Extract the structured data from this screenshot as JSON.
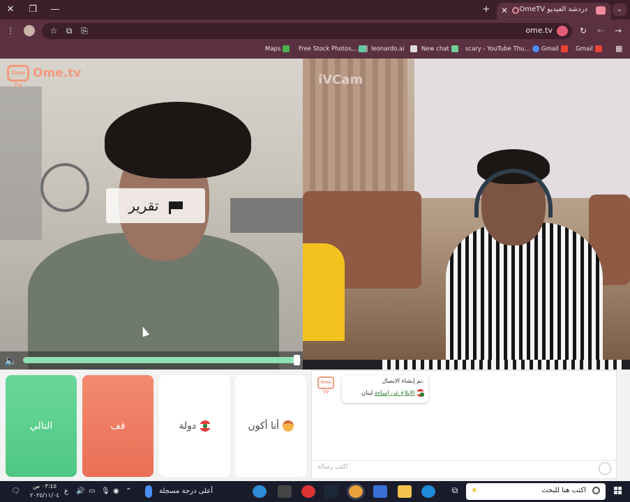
{
  "browser": {
    "tab_title": "دردشة الفيديو OmeTV — بد",
    "url": "ome.tv",
    "window_controls": [
      "close-icon",
      "restore-icon",
      "minimize-icon"
    ],
    "bookmarks": [
      {
        "label": "Maps",
        "icon": "maps-icon"
      },
      {
        "label": "Free Stock Photos,...",
        "icon": "photos-icon"
      },
      {
        "label": "leonardo.ai",
        "icon": "leonardo-icon"
      },
      {
        "label": "New chat",
        "icon": "chatgpt-icon"
      },
      {
        "label": "scary - YouTube Thu...",
        "icon": "web-icon"
      },
      {
        "label": "Gmail",
        "icon": "gmail-icon"
      },
      {
        "label": "Gmail",
        "icon": "gmail-icon"
      }
    ]
  },
  "video": {
    "logo_word": "Ome.tv",
    "logo_badge": "Ome TV",
    "watermark": "iVCam",
    "report_label": "تقرير",
    "volume_level": 0.99
  },
  "controls": {
    "next_label": "التالي",
    "stop_label": "قف",
    "country_label": "دولة",
    "gender_label": "أنا أكون"
  },
  "chat": {
    "line1": "تم إنشاء الاتصال.",
    "country": "لبنان",
    "report_link": "الإبلاغ عن إساءة",
    "placeholder": "اكتب رسالة"
  },
  "taskbar": {
    "search_placeholder": "اكتب هنا للبحث",
    "weather": "أعلى درجة مسجلة",
    "time": "٠٣:٤٥ ص",
    "date": "٢٠٢٥/١١/٠٤",
    "lang": "ع"
  },
  "colors": {
    "next": "#4fc882",
    "stop": "#ea6f56",
    "brand": "#f39a7d",
    "browser_frame": "#5b3040"
  }
}
